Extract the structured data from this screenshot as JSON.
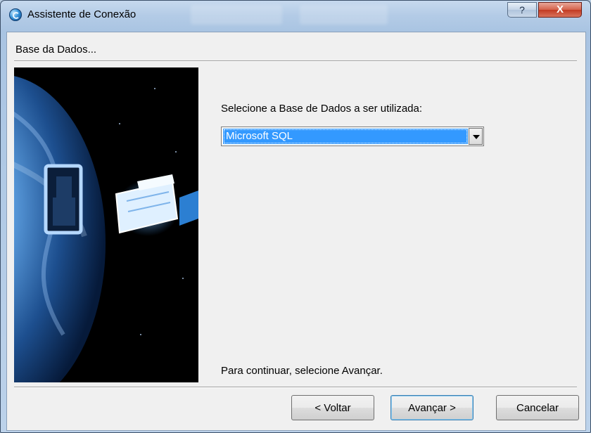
{
  "window": {
    "title": "Assistente de Conexão",
    "help_label": "?",
    "close_label": "X"
  },
  "wizard": {
    "page_title": "Base da Dados...",
    "prompt": "Selecione a Base de Dados a ser utilizada:",
    "database_select": {
      "selected": "Microsoft SQL"
    },
    "hint": "Para continuar, selecione Avançar."
  },
  "buttons": {
    "back": "< Voltar",
    "next": "Avançar >",
    "cancel": "Cancelar"
  },
  "colors": {
    "selection": "#3399ff",
    "close_button": "#c23a22",
    "panel": "#f0f0f0"
  }
}
